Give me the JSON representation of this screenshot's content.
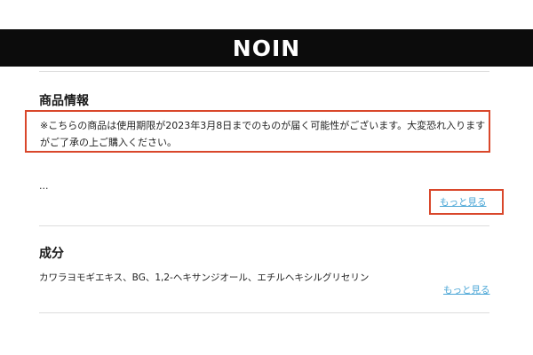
{
  "header": {
    "brand": "NOIN"
  },
  "product_info": {
    "heading": "商品情報",
    "notice": "※こちらの商品は使用期限が2023年3月8日までのものが届く可能性がございます。大変恐れ入りますがご了承の上ご購入ください。",
    "ellipsis": "…",
    "more_label": "もっと見る"
  },
  "ingredients": {
    "heading": "成分",
    "text": "カワラヨモギエキス、BG、1,2-ヘキサンジオール、エチルヘキシルグリセリン",
    "more_label": "もっと見る"
  },
  "colors": {
    "header_bg": "#0c0c0c",
    "highlight_border": "#d9472b",
    "link": "#4aa6d6"
  }
}
